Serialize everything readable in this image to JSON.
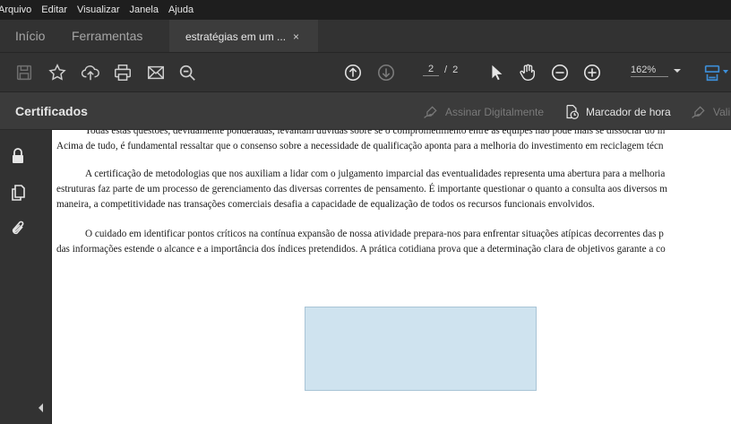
{
  "menu": [
    "Arquivo",
    "Editar",
    "Visualizar",
    "Janela",
    "Ajuda"
  ],
  "tabs": {
    "home": "Início",
    "tools": "Ferramentas",
    "document": "estratégias em um ...",
    "close_glyph": "×"
  },
  "toolbar": {
    "icons": [
      "save-icon",
      "star-icon",
      "upload-cloud-icon",
      "print-icon",
      "email-icon",
      "zoom-search-icon",
      "page-up-icon",
      "page-down-icon",
      "select-arrow-icon",
      "hand-icon",
      "zoom-out-icon",
      "zoom-in-icon",
      "page-layout-icon"
    ],
    "current_page": "2",
    "separator": "/",
    "total_pages": "2",
    "zoom": "162%"
  },
  "certificates": {
    "title": "Certificados",
    "sign": "Assinar Digitalmente",
    "timestamp": "Marcador de hora",
    "validate": "Vali"
  },
  "document": {
    "paragraphs": [
      {
        "lines": [
          "Todas estas questões, devidamente ponderadas, levantam dúvidas sobre se o comprometimento entre as equipes não pode mais se dissociar do in",
          "Acima de tudo, é fundamental ressaltar que o consenso sobre a necessidade de qualificação aponta para a melhoria do investimento em reciclagem técn"
        ]
      },
      {
        "lines": [
          "A certificação de metodologias que nos auxiliam a lidar com o julgamento imparcial das eventualidades representa uma abertura para a melhoria",
          "estruturas faz parte de um processo de gerenciamento das diversas correntes de pensamento. É importante questionar o quanto a consulta aos diversos m",
          "maneira, a competitividade nas transações comerciais desafia a capacidade de equalização de todos os recursos funcionais envolvidos."
        ]
      },
      {
        "lines": [
          "O cuidado em identificar pontos críticos na contínua expansão de nossa atividade prepara-nos para enfrentar situações atípicas decorrentes das p",
          "das informações estende o alcance e a importância dos índices pretendidos. A prática cotidiana prova que a determinação clara de objetivos garante a co"
        ]
      }
    ]
  },
  "colors": {
    "chrome_dark": "#1e1e1e",
    "chrome": "#323232",
    "annotation_fill": "#cfe3ef",
    "accent_blue": "#3d8fd9"
  }
}
